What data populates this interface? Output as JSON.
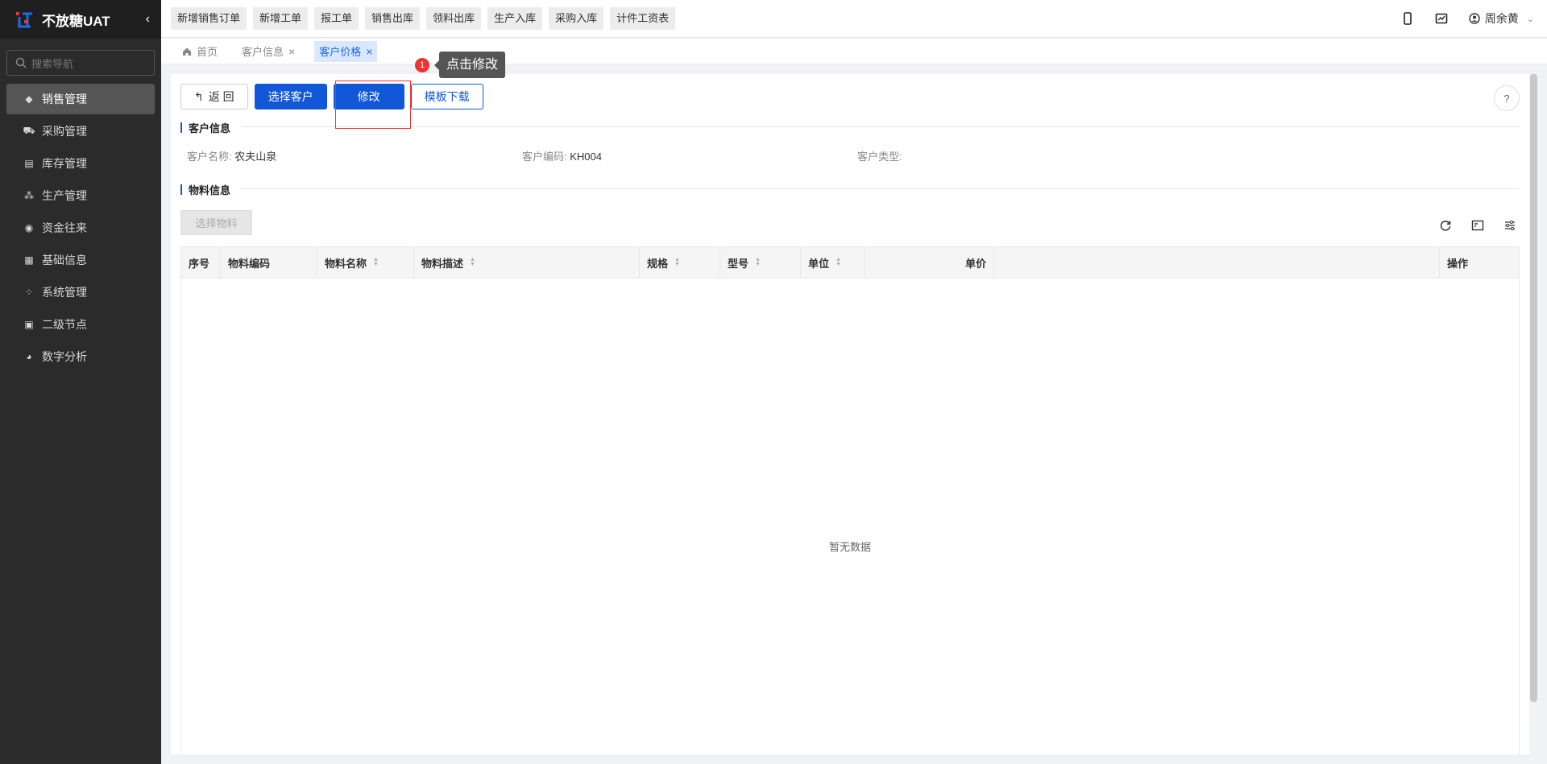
{
  "sidebar": {
    "brand": "不放糖UAT",
    "search_placeholder": "搜索导航",
    "items": [
      {
        "label": "销售管理",
        "icon": "tag-icon"
      },
      {
        "label": "采购管理",
        "icon": "cart-icon"
      },
      {
        "label": "库存管理",
        "icon": "box-icon"
      },
      {
        "label": "生产管理",
        "icon": "nodes-icon"
      },
      {
        "label": "资金往来",
        "icon": "money-icon"
      },
      {
        "label": "基础信息",
        "icon": "grid-icon"
      },
      {
        "label": "系统管理",
        "icon": "apps-icon"
      },
      {
        "label": "二级节点",
        "icon": "doc-icon"
      },
      {
        "label": "数字分析",
        "icon": "pie-icon"
      }
    ]
  },
  "topbar": {
    "quick": [
      "新增销售订单",
      "新增工单",
      "报工单",
      "销售出库",
      "领料出库",
      "生产入库",
      "采购入库",
      "计件工资表"
    ],
    "user": "周余黄"
  },
  "tabs": [
    {
      "label": "首页"
    },
    {
      "label": "客户信息"
    },
    {
      "label": "客户价格"
    }
  ],
  "tooltip": {
    "step": "1",
    "text": "点击修改"
  },
  "actions": {
    "back": "返 回",
    "select_customer": "选择客户",
    "edit": "修改",
    "template": "模板下载"
  },
  "customer": {
    "title": "客户信息",
    "name_label": "客户名称:",
    "name": "农夫山泉",
    "code_label": "客户编码:",
    "code": "KH004",
    "type_label": "客户类型:",
    "type": ""
  },
  "material": {
    "title": "物料信息",
    "select_btn": "选择物料",
    "columns": [
      "序号",
      "物料编码",
      "物料名称",
      "物料描述",
      "规格",
      "型号",
      "单位",
      "单价",
      "",
      "操作"
    ],
    "empty": "暂无数据"
  },
  "colors": {
    "primary": "#1157d8",
    "sidebar": "#2b2b2b",
    "annotation": "#ee3333"
  }
}
